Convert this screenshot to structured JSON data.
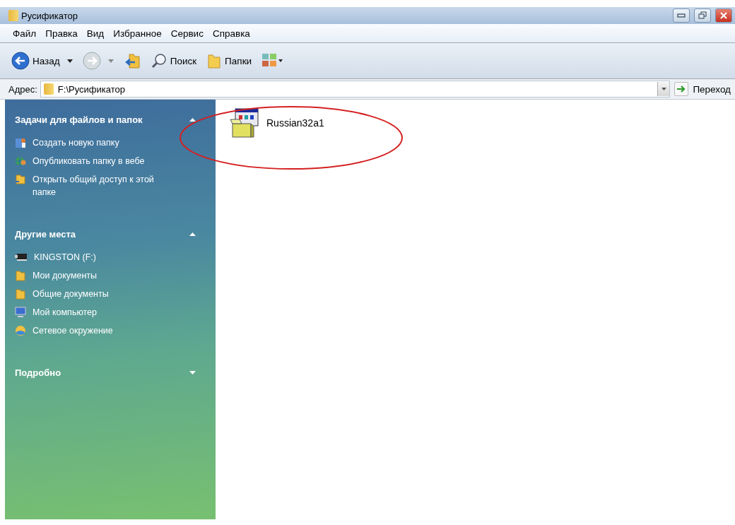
{
  "window": {
    "title": "Русификатор"
  },
  "menu": [
    "Файл",
    "Правка",
    "Вид",
    "Избранное",
    "Сервис",
    "Справка"
  ],
  "toolbar": [
    {
      "kind": "back",
      "label": "Назад"
    },
    {
      "kind": "forward"
    },
    {
      "kind": "up"
    },
    {
      "kind": "search",
      "label": "Поиск"
    },
    {
      "kind": "folders",
      "label": "Папки"
    },
    {
      "kind": "views"
    }
  ],
  "address": {
    "label": "Адрес:",
    "value": "F:\\Русификатор",
    "go": "Переход"
  },
  "sidebar": [
    {
      "title": "Задачи для файлов и папок",
      "expanded": true,
      "items": [
        {
          "label": "Создать новую папку"
        },
        {
          "label": "Опубликовать папку в вебе"
        },
        {
          "label": "Открыть общий доступ к этой папке"
        }
      ]
    },
    {
      "title": "Другие места",
      "expanded": true,
      "items": [
        {
          "label": "KINGSTON (F:)"
        },
        {
          "label": "Мои документы"
        },
        {
          "label": "Общие документы"
        },
        {
          "label": "Мой компьютер"
        },
        {
          "label": "Сетевое окружение"
        }
      ]
    },
    {
      "title": "Подробно",
      "expanded": false
    }
  ],
  "files": [
    {
      "name": "Russian32a1",
      "kind": "installer"
    }
  ]
}
